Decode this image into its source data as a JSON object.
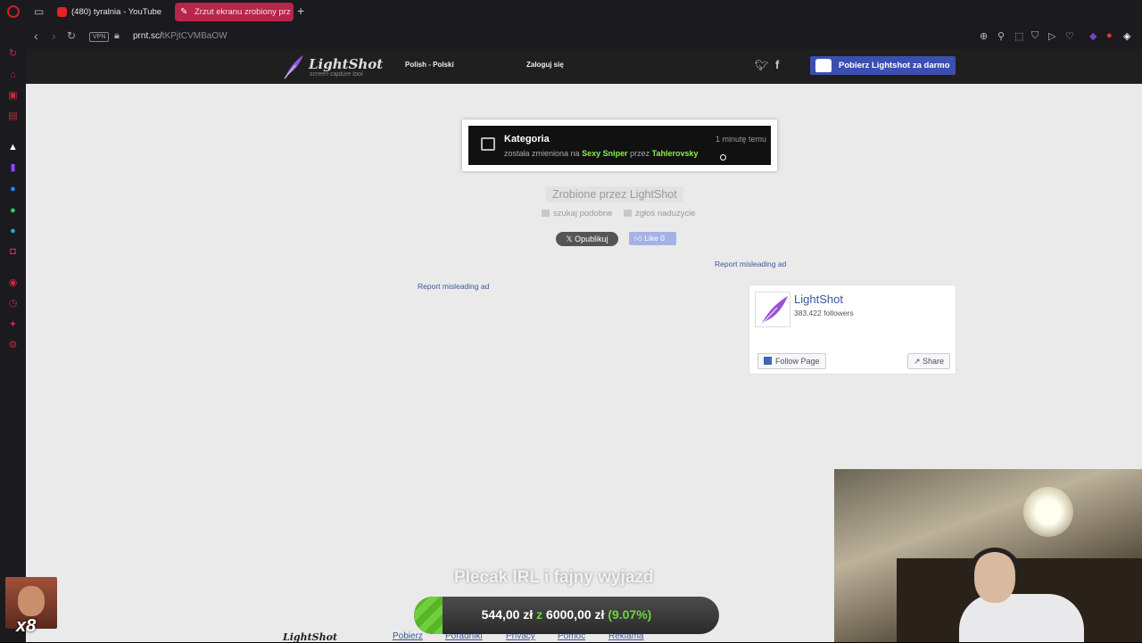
{
  "browser": {
    "tabs": [
      {
        "label": "(480) tyralnia - YouTube"
      },
      {
        "label": "Zrzut ekranu zrobiony prz"
      }
    ],
    "vpn_label": "VPN",
    "url_domain": "prnt.sc/",
    "url_path": "tKPjtCVMBaOW"
  },
  "lightshot": {
    "logo_name": "LightShot",
    "logo_sub": "screen capture tool",
    "language": "Polish - Polski",
    "login": "Zaloguj się",
    "download_button": "Pobierz Lightshot za darmo",
    "screenshot": {
      "title": "Kategoria",
      "time": "1 minutę temu",
      "msg_prefix": "została zmieniona na",
      "category": "Sexy Sniper",
      "msg_mid": "przez",
      "user": "Tahlerovsky"
    },
    "made_by": "Zrobione przez LightShot",
    "search_similar": "szukaj podobne",
    "report_abuse": "zgłoś nadużycie",
    "tweet_label": "Opublikuj",
    "like_label": "Like 0",
    "report_ad": "Report misleading ad",
    "fb_page": {
      "name": "LightShot",
      "followers": "383,422 followers",
      "follow_label": "Follow Page",
      "share_label": "Share"
    },
    "footer": {
      "logo": "LightShot",
      "links": [
        "Pobierz",
        "Poradniki",
        "Privacy",
        "Pomoc",
        "Reklama"
      ]
    }
  },
  "stream": {
    "goal_title": "Plecak IRL i fajny wyjazd",
    "goal_current": "544,00 zł",
    "goal_sep": "z",
    "goal_target": "6000,00 zł",
    "goal_percent": "(9.07%)",
    "goal_fraction": 0.0907,
    "emote_count": "x8"
  },
  "colors": {
    "accent_tab": "#b8244a",
    "download_button": "#3a4fb0",
    "highlight_green": "#8bf04a",
    "goal_green": "#6fcf3c"
  }
}
